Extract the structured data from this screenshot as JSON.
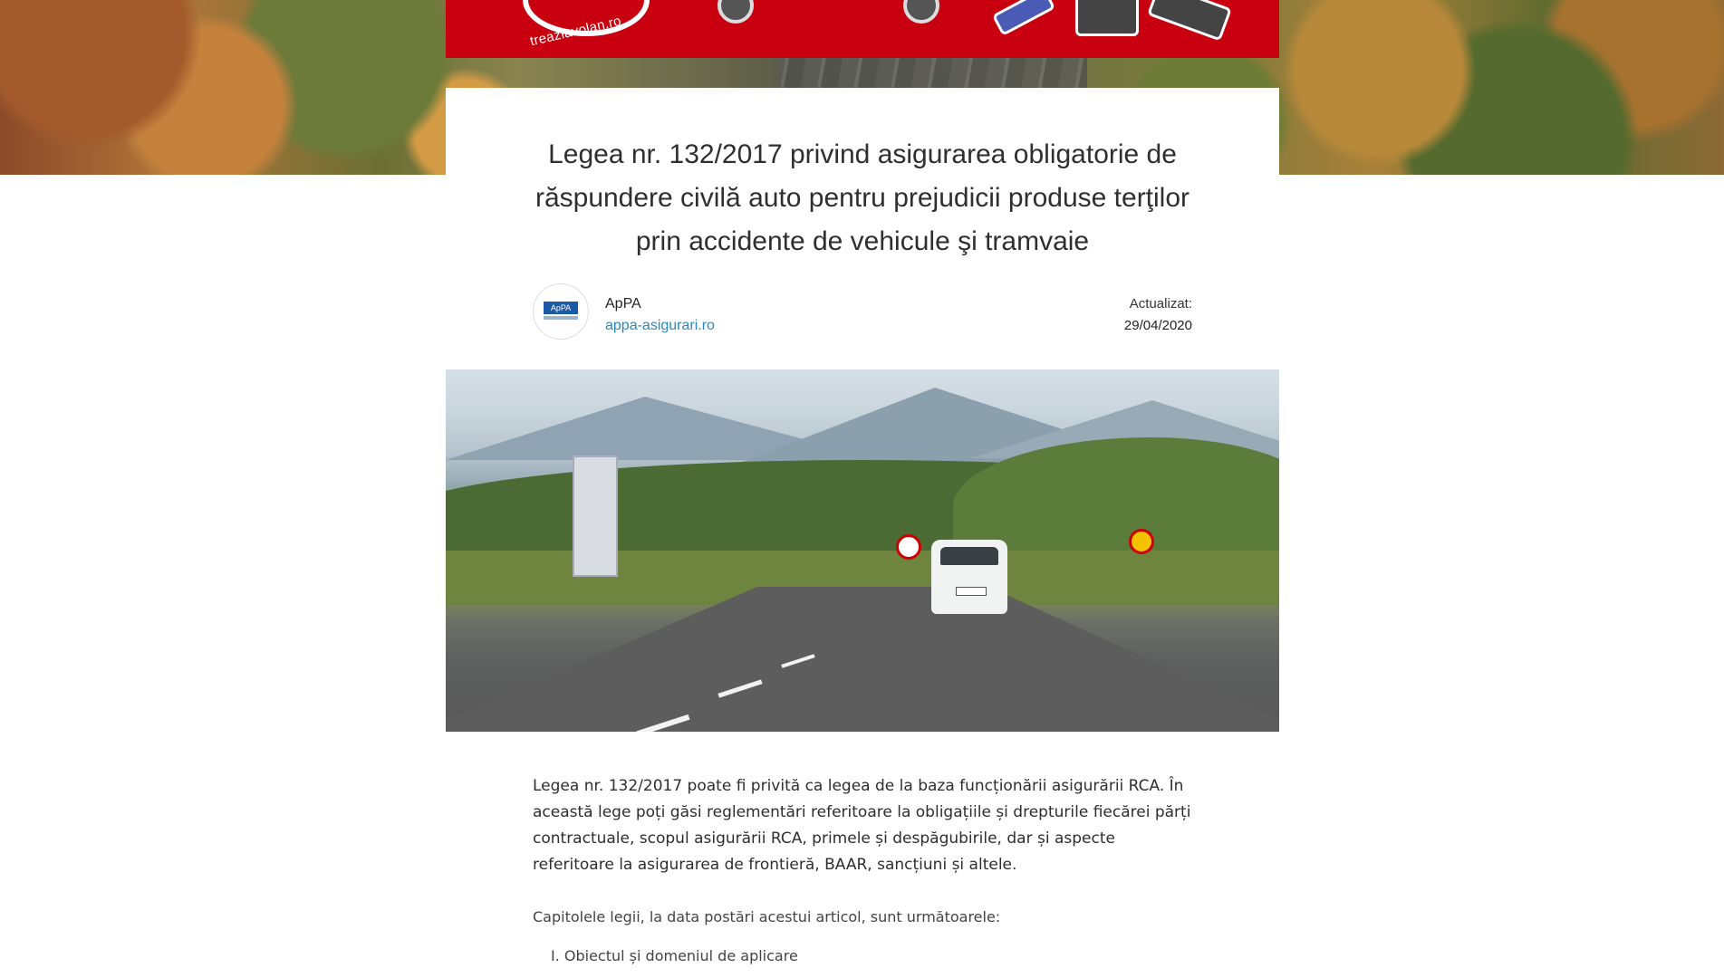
{
  "banner": {
    "logo_text": "treazlavolan.ro",
    "background_color": "#c8000f"
  },
  "article": {
    "title": "Legea nr. 132/2017 privind asigurarea obligatorie de răspundere civilă auto pentru prejudicii produse terţilor prin accidente de vehicule şi tramvaie",
    "author": {
      "name": "ApPA",
      "website": "appa-asigurari.ro",
      "avatar_text": "ApPA"
    },
    "updated": {
      "label": "Actualizat:",
      "date": "29/04/2020"
    },
    "intro": "Legea nr. 132/2017 poate fi privită ca legea de la baza funcționării asigurării RCA. În această lege poți găsi reglementări referitoare la obligațiile și drepturile fiecărei părți contractuale, scopul asigurării RCA, primele și despăgubirile, dar și aspecte referitoare la asigurarea de frontieră, BAAR, sancțiuni și altele.",
    "chapters_intro": "Capitolele legii, la data postări acestui articol, sunt următoarele:",
    "chapters": [
      "I. Obiectul și domeniul de aplicare"
    ]
  },
  "colors": {
    "link": "#2a8ab6",
    "text": "#2e2e2e"
  }
}
